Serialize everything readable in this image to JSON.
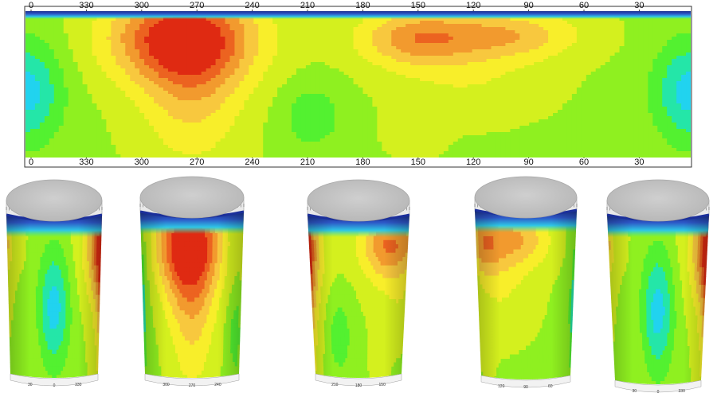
{
  "chart_data": {
    "type": "heatmap",
    "x_axis": {
      "ticks": [
        "0",
        "330",
        "300",
        "270",
        "240",
        "210",
        "180",
        "150",
        "120",
        "90",
        "60",
        "30"
      ],
      "range_degrees": [
        360,
        0
      ]
    },
    "unwrapped_map": {
      "hotspots": [
        {
          "angle_deg": 275,
          "depth": 0.2,
          "level": "highest"
        },
        {
          "angle_deg": 150,
          "depth": 0.2,
          "level": "high"
        },
        {
          "angle_deg": 100,
          "depth": 0.18,
          "level": "high"
        }
      ],
      "coolspots": [
        {
          "angle_deg": 360,
          "depth": 0.6,
          "level": "low"
        },
        {
          "angle_deg": 5,
          "depth": 0.6,
          "level": "low"
        },
        {
          "angle_deg": 205,
          "depth": 0.7,
          "level": "medium-low"
        }
      ]
    },
    "cylinder_views": [
      {
        "name": "view-0",
        "top_ticks": [
          "30",
          "0",
          "330",
          "30"
        ],
        "bottom_ticks": [
          "30",
          "0",
          "330"
        ]
      },
      {
        "name": "view-270",
        "top_ticks": [
          "300",
          "270",
          "240"
        ],
        "bottom_ticks": [
          "300",
          "270",
          "240"
        ]
      },
      {
        "name": "view-180",
        "top_ticks": [
          "210",
          "180",
          "150"
        ],
        "bottom_ticks": [
          "210",
          "180",
          "150"
        ]
      },
      {
        "name": "view-90",
        "top_ticks": [
          "120",
          "90",
          "60"
        ],
        "bottom_ticks": [
          "120",
          "90",
          "60"
        ]
      },
      {
        "name": "view-0-repeat",
        "top_ticks": [
          "30",
          "0",
          "330",
          "30"
        ],
        "bottom_ticks": [
          "30",
          "0",
          "330"
        ]
      }
    ],
    "colormap": [
      "#1f3fa0",
      "#21d3ef",
      "#24e6a8",
      "#53f130",
      "#8ff020",
      "#d4f01e",
      "#f8ee2a",
      "#f8c83e",
      "#f29a2e",
      "#ec6320",
      "#df2a12"
    ]
  }
}
